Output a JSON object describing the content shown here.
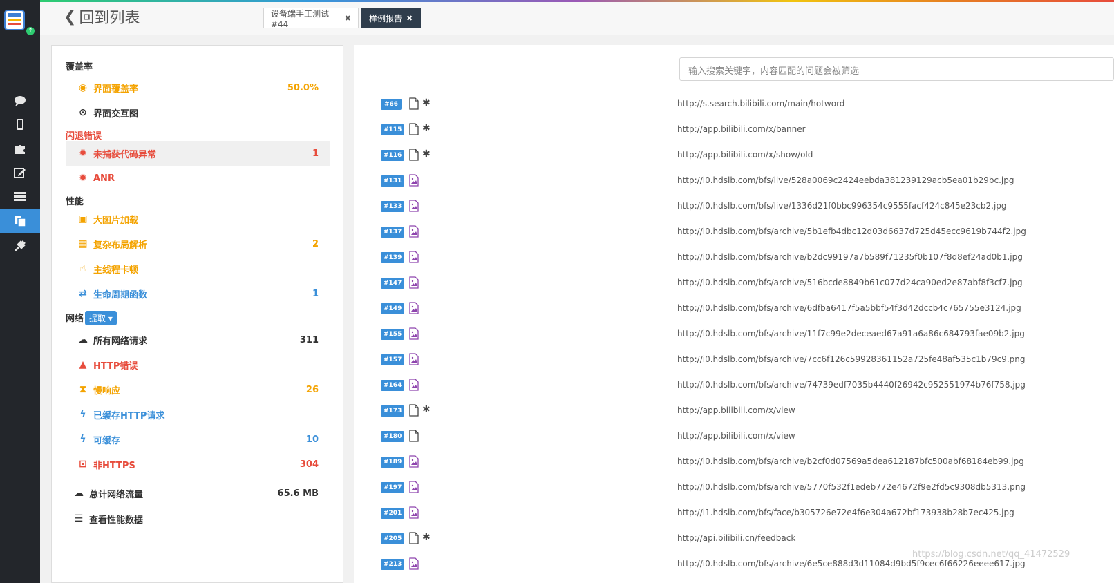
{
  "app": {
    "title": "回到列表"
  },
  "tabs": [
    {
      "label": "设备端手工测试#44",
      "close": "✖"
    },
    {
      "label": "样例报告",
      "close": "✖"
    }
  ],
  "nav_icons": [
    "chat-icon",
    "mobile-icon",
    "puzzle-icon",
    "edit-icon",
    "list-icon",
    "copy-icon",
    "plug-icon"
  ],
  "sidebar": {
    "coverage_title": "覆盖率",
    "coverage_items": [
      {
        "label": "界面覆盖率",
        "value": "50.0%",
        "icon": "target-icon"
      },
      {
        "label": "界面交互图",
        "value": "",
        "icon": "dot-circle-icon"
      }
    ],
    "crash_title": "闪退错误",
    "crash_items": [
      {
        "label": "未捕获代码异常",
        "value": "1",
        "icon": "bug-icon"
      },
      {
        "label": "ANR",
        "value": "",
        "icon": "bug-icon"
      }
    ],
    "perf_title": "性能",
    "perf_items": [
      {
        "label": "大图片加载",
        "value": "",
        "icon": "image-icon"
      },
      {
        "label": "复杂布局解析",
        "value": "2",
        "icon": "grid-icon"
      },
      {
        "label": "主线程卡顿",
        "value": "",
        "icon": "hand-icon"
      },
      {
        "label": "生命周期函数",
        "value": "1",
        "icon": "exchange-icon"
      }
    ],
    "network_title": "网络",
    "network_fetch": "提取",
    "network_items": [
      {
        "label": "所有网络请求",
        "value": "311",
        "icon": "cloud-icon"
      },
      {
        "label": "HTTP错误",
        "value": "",
        "icon": "warning-icon"
      },
      {
        "label": "慢响应",
        "value": "26",
        "icon": "hourglass-icon"
      },
      {
        "label": "已缓存HTTP请求",
        "value": "",
        "icon": "bolt-icon"
      },
      {
        "label": "可缓存",
        "value": "10",
        "icon": "bolt-icon"
      },
      {
        "label": "非HTTPS",
        "value": "304",
        "icon": "lock-icon"
      }
    ],
    "total_traffic_label": "总计网络流量",
    "total_traffic_value": "65.6 MB",
    "perf_data_label": "查看性能数据"
  },
  "search": {
    "placeholder": "输入搜索关键字，内容匹配的问题会被筛选"
  },
  "issues": [
    {
      "id": "#66",
      "type": "file",
      "star": true,
      "url": "http://s.search.bilibili.com/main/hotword"
    },
    {
      "id": "#115",
      "type": "file",
      "star": true,
      "url": "http://app.bilibili.com/x/banner"
    },
    {
      "id": "#116",
      "type": "file",
      "star": true,
      "url": "http://app.bilibili.com/x/show/old"
    },
    {
      "id": "#131",
      "type": "image",
      "star": false,
      "url": "http://i0.hdslb.com/bfs/live/528a0069c2424eebda381239129acb5ea01b29bc.jpg"
    },
    {
      "id": "#133",
      "type": "image",
      "star": false,
      "url": "http://i0.hdslb.com/bfs/live/1336d21f0bbc996354c9555facf424c845e23cb2.jpg"
    },
    {
      "id": "#137",
      "type": "image",
      "star": false,
      "url": "http://i0.hdslb.com/bfs/archive/5b1efb4dbc12d03d6637d725d45ecc9619b744f2.jpg"
    },
    {
      "id": "#139",
      "type": "image",
      "star": false,
      "url": "http://i0.hdslb.com/bfs/archive/b2dc99197a7b589f71235f0b107f8d8ef24ad0b1.jpg"
    },
    {
      "id": "#147",
      "type": "image",
      "star": false,
      "url": "http://i0.hdslb.com/bfs/archive/516bcde8849b61c077d24ca90ed2e87abf8f3cf7.jpg"
    },
    {
      "id": "#149",
      "type": "image",
      "star": false,
      "url": "http://i0.hdslb.com/bfs/archive/6dfba6417f5a5bbf54f3d42dccb4c765755e3124.jpg"
    },
    {
      "id": "#155",
      "type": "image",
      "star": false,
      "url": "http://i0.hdslb.com/bfs/archive/11f7c99e2deceaed67a91a6a86c684793fae09b2.jpg"
    },
    {
      "id": "#157",
      "type": "image",
      "star": false,
      "url": "http://i0.hdslb.com/bfs/archive/7cc6f126c59928361152a725fe48af535c1b79c9.png"
    },
    {
      "id": "#164",
      "type": "image",
      "star": false,
      "url": "http://i0.hdslb.com/bfs/archive/74739edf7035b4440f26942c952551974b76f758.jpg"
    },
    {
      "id": "#173",
      "type": "file",
      "star": true,
      "url": "http://app.bilibili.com/x/view"
    },
    {
      "id": "#180",
      "type": "file",
      "star": false,
      "url": "http://app.bilibili.com/x/view"
    },
    {
      "id": "#189",
      "type": "image",
      "star": false,
      "url": "http://i0.hdslb.com/bfs/archive/b2cf0d07569a5dea612187bfc500abf68184eb99.jpg"
    },
    {
      "id": "#197",
      "type": "image",
      "star": false,
      "url": "http://i0.hdslb.com/bfs/archive/5770f532f1edeb772e4672f9e2fd5c9308db5313.png"
    },
    {
      "id": "#201",
      "type": "image",
      "star": false,
      "url": "http://i1.hdslb.com/bfs/face/b305726e72e4f6e304a672bf173938b28b7ec425.jpg"
    },
    {
      "id": "#205",
      "type": "file",
      "star": true,
      "url": "http://api.bilibili.cn/feedback"
    },
    {
      "id": "#213",
      "type": "image",
      "star": false,
      "url": "http://i0.hdslb.com/bfs/archive/6e5ce888d3d11084d9bd5f9cec6f66226eeee617.jpg"
    }
  ],
  "watermark": "https://blog.csdn.net/qq_41472529",
  "colors": {
    "accent": "#3a8fd9",
    "warning": "#f4a300",
    "danger": "#e74c3c",
    "dark_nav": "#23262b"
  }
}
